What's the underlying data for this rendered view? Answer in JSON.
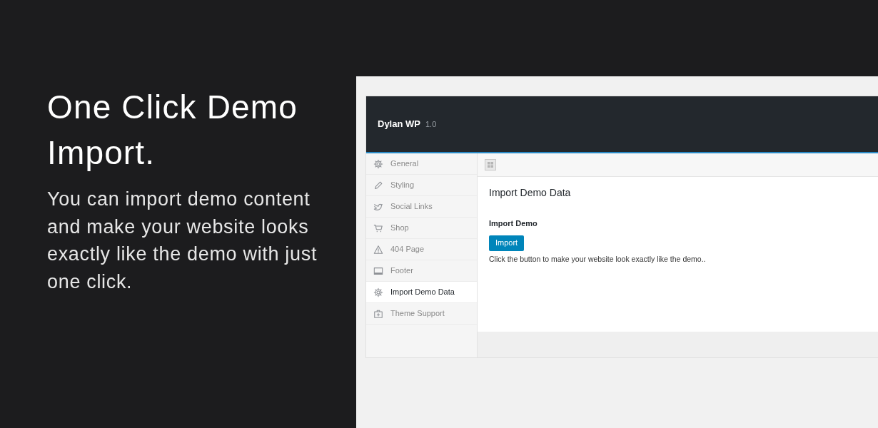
{
  "promo": {
    "headline": "One Click Demo Import.",
    "body": "You can import demo content and make your website looks exactly like the demo with just one click."
  },
  "app": {
    "title": "Dylan WP",
    "version": "1.0",
    "sidebar": {
      "items": [
        {
          "label": "General",
          "selected": false
        },
        {
          "label": "Styling",
          "selected": false
        },
        {
          "label": "Social Links",
          "selected": false
        },
        {
          "label": "Shop",
          "selected": false
        },
        {
          "label": "404 Page",
          "selected": false
        },
        {
          "label": "Footer",
          "selected": false
        },
        {
          "label": "Import Demo Data",
          "selected": true
        },
        {
          "label": "Theme Support",
          "selected": false
        }
      ]
    },
    "content": {
      "heading": "Import Demo Data",
      "section_label": "Import Demo",
      "button": "Import",
      "description": "Click the button to make your website look exactly like the demo.."
    }
  }
}
